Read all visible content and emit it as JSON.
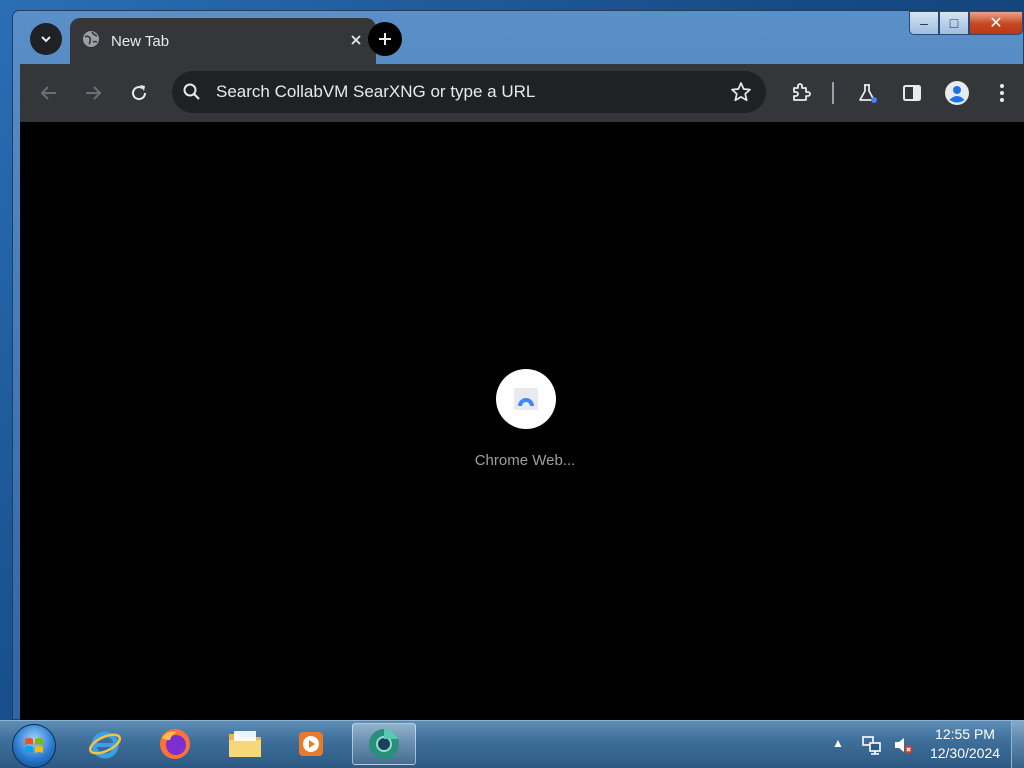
{
  "window": {
    "controls": {
      "minimize": "–",
      "maximize": "□",
      "close": "✕"
    }
  },
  "tabs": [
    {
      "title": "New Tab",
      "favicon": "globe-icon",
      "active": true
    }
  ],
  "toolbar": {
    "omnibox_placeholder": "Search CollabVM SearXNG or type a URL",
    "icons": [
      "back-arrow-icon",
      "forward-arrow-icon",
      "reload-icon",
      "bookmark-star-icon",
      "extensions-icon",
      "labs-flask-icon",
      "side-panel-icon",
      "profile-avatar-icon",
      "more-menu-icon"
    ]
  },
  "content": {
    "loading_label": "Chrome Web..."
  },
  "taskbar": {
    "apps": [
      "internet-explorer-icon",
      "firefox-icon",
      "file-explorer-icon",
      "media-player-icon",
      "chrome-icon"
    ],
    "clock_time": "12:55 PM",
    "clock_date": "12/30/2024"
  },
  "colors": {
    "chrome_toolbar": "#35363a",
    "omnibox": "#202124",
    "content": "#000000",
    "accent_blue": "#4285f4"
  }
}
